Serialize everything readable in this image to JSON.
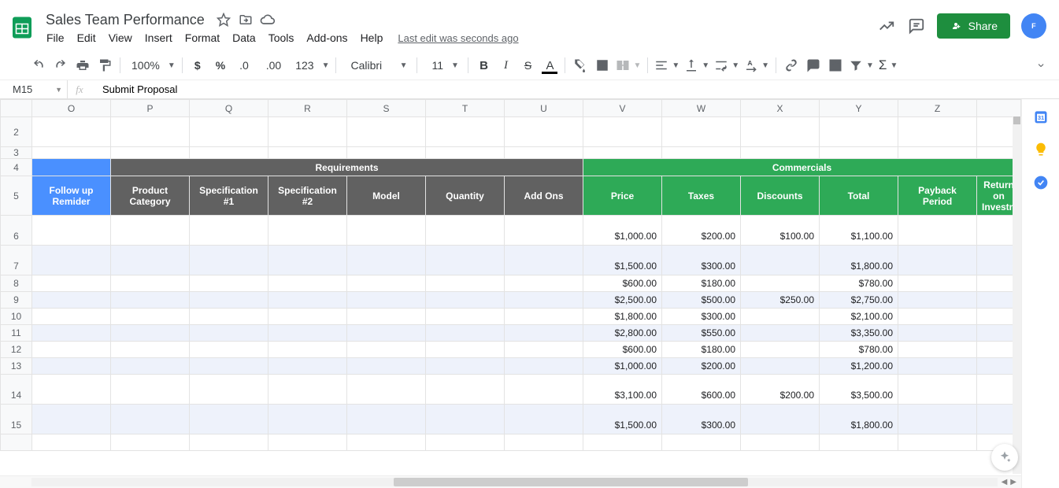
{
  "doc": {
    "title": "Sales Team Performance",
    "last_edit": "Last edit was seconds ago"
  },
  "menus": [
    "File",
    "Edit",
    "View",
    "Insert",
    "Format",
    "Data",
    "Tools",
    "Add-ons",
    "Help"
  ],
  "share": {
    "label": "Share"
  },
  "toolbar": {
    "zoom": "100%",
    "font": "Calibri",
    "font_size": "11"
  },
  "name_box": "M15",
  "formula": "Submit Proposal",
  "columns": [
    "O",
    "P",
    "Q",
    "R",
    "S",
    "T",
    "U",
    "V",
    "W",
    "X",
    "Y",
    "Z"
  ],
  "row_labels": [
    "2",
    "3",
    "4",
    "5",
    "6",
    "7",
    "8",
    "9",
    "10",
    "11",
    "12",
    "13",
    "14",
    "15"
  ],
  "band_labels": {
    "requirements": "Requirements",
    "commercials": "Commercials"
  },
  "headers2": {
    "O": "Follow up Remider",
    "P": "Product Category",
    "Q": "Specification #1",
    "R": "Specification #2",
    "S": "Model",
    "T": "Quantity",
    "U": "Add Ons",
    "V": "Price",
    "W": "Taxes",
    "X": "Discounts",
    "Y": "Total",
    "Z": "Payback Period",
    "AA": "Return on Investment"
  },
  "rows": [
    {
      "n": "6",
      "tall": true,
      "alt": false,
      "V": "$1,000.00",
      "W": "$200.00",
      "X": "$100.00",
      "Y": "$1,100.00"
    },
    {
      "n": "7",
      "tall": true,
      "alt": true,
      "V": "$1,500.00",
      "W": "$300.00",
      "X": "",
      "Y": "$1,800.00"
    },
    {
      "n": "8",
      "tall": false,
      "alt": false,
      "V": "$600.00",
      "W": "$180.00",
      "X": "",
      "Y": "$780.00"
    },
    {
      "n": "9",
      "tall": false,
      "alt": true,
      "V": "$2,500.00",
      "W": "$500.00",
      "X": "$250.00",
      "Y": "$2,750.00"
    },
    {
      "n": "10",
      "tall": false,
      "alt": false,
      "V": "$1,800.00",
      "W": "$300.00",
      "X": "",
      "Y": "$2,100.00"
    },
    {
      "n": "11",
      "tall": false,
      "alt": true,
      "V": "$2,800.00",
      "W": "$550.00",
      "X": "",
      "Y": "$3,350.00"
    },
    {
      "n": "12",
      "tall": false,
      "alt": false,
      "V": "$600.00",
      "W": "$180.00",
      "X": "",
      "Y": "$780.00"
    },
    {
      "n": "13",
      "tall": false,
      "alt": true,
      "V": "$1,000.00",
      "W": "$200.00",
      "X": "",
      "Y": "$1,200.00"
    },
    {
      "n": "14",
      "tall": true,
      "alt": false,
      "V": "$3,100.00",
      "W": "$600.00",
      "X": "$200.00",
      "Y": "$3,500.00"
    },
    {
      "n": "15",
      "tall": true,
      "alt": true,
      "V": "$1,500.00",
      "W": "$300.00",
      "X": "",
      "Y": "$1,800.00"
    }
  ]
}
